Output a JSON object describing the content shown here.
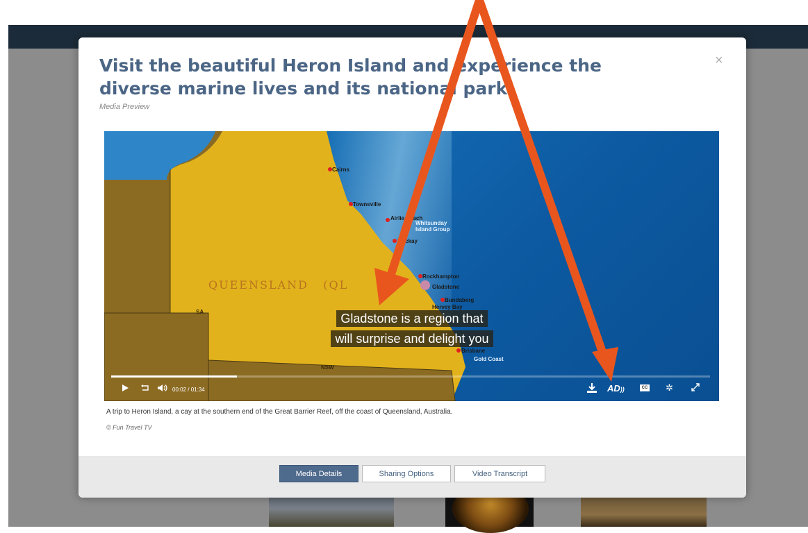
{
  "modal": {
    "title": "Visit the beautiful Heron Island and experience the diverse marine lives and its national park",
    "subtitle": "Media Preview",
    "close_label": "×"
  },
  "video": {
    "state_label": "QUEENSLAND",
    "state_label_2": "(QL",
    "neighbor_states": [
      "SA",
      "NSW"
    ],
    "cities": [
      {
        "name": "Cairns"
      },
      {
        "name": "Townsville"
      },
      {
        "name": "Airlie Beach"
      },
      {
        "name": "Whitsunday Island Group"
      },
      {
        "name": "Mackay"
      },
      {
        "name": "Rockhampton"
      },
      {
        "name": "Gladstone"
      },
      {
        "name": "Bundaberg"
      },
      {
        "name": "Hervey Bay"
      },
      {
        "name": "Brisbane"
      },
      {
        "name": "Gold Coast"
      }
    ],
    "caption_line1": "Gladstone is a region that",
    "caption_line2": "will surprise and delight you",
    "time": "00:02 / 01:34",
    "progress": 0.21,
    "controls": {
      "play_icon": "play-icon",
      "rewind_icon": "rewind-10-icon",
      "volume_icon": "volume-icon",
      "download_icon": "download-icon",
      "ad_label": "AD",
      "cc_label": "CC",
      "settings_icon": "gear-icon",
      "fullscreen_icon": "fullscreen-icon"
    }
  },
  "description": "A trip to Heron Island, a cay at the southern end of the Great Barrier Reef, off the coast of Queensland, Australia.",
  "credit": "© Fun Travel TV",
  "footer": {
    "tabs": [
      {
        "label": "Media Details",
        "active": true
      },
      {
        "label": "Sharing Options",
        "active": false
      },
      {
        "label": "Video Transcript",
        "active": false
      }
    ]
  },
  "colors": {
    "title": "#4b6585",
    "annotation_arrow": "#e8561e",
    "active_tab": "#4e6a8c"
  }
}
